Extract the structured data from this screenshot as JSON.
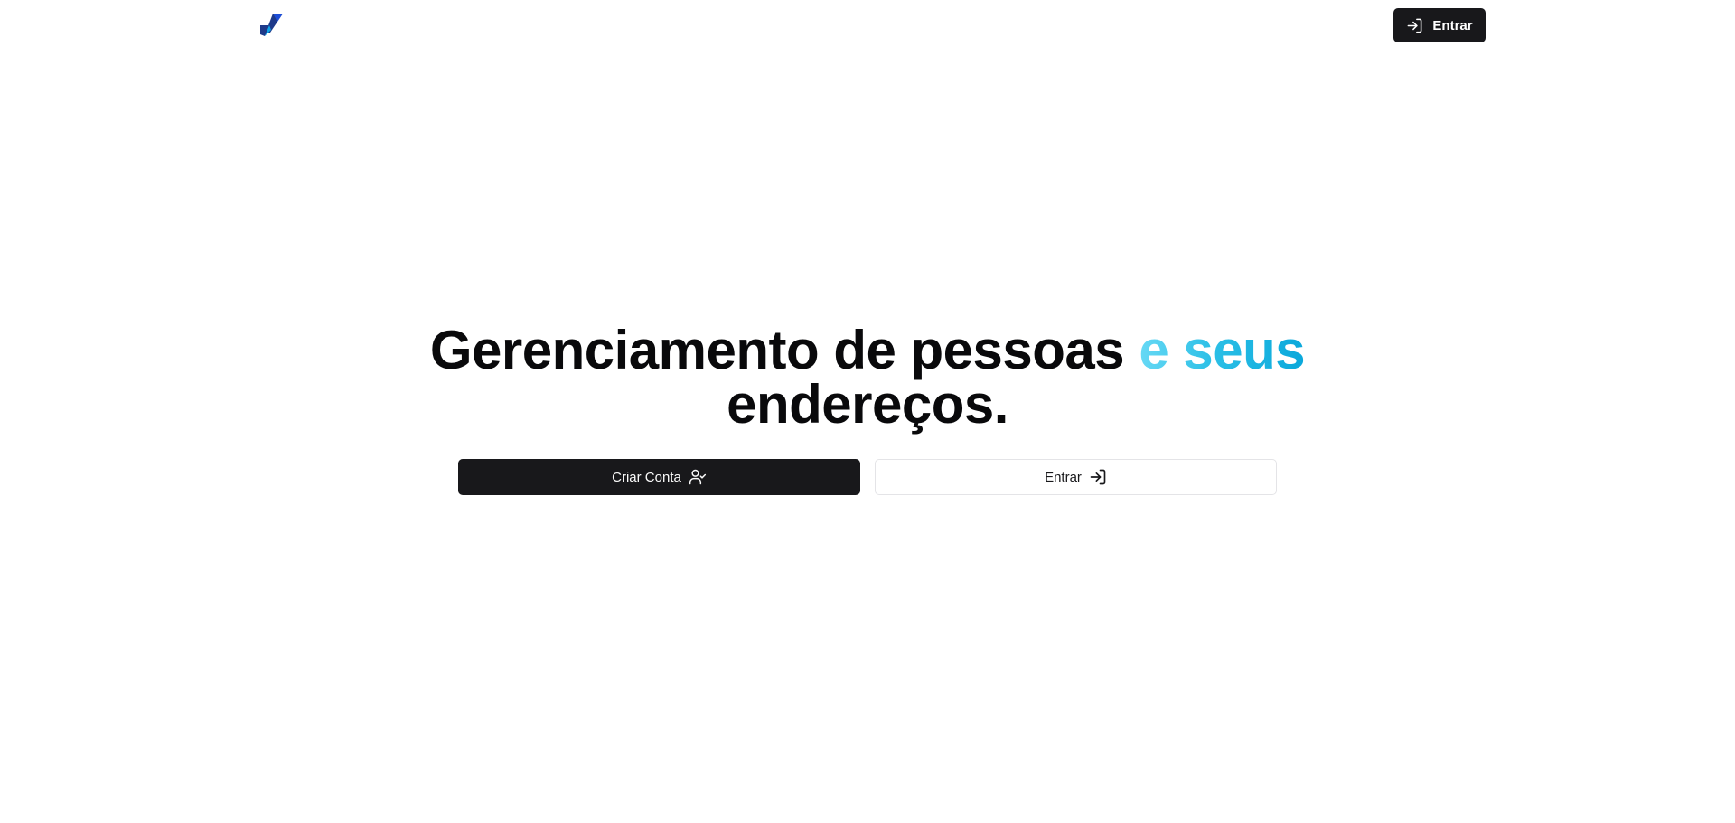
{
  "header": {
    "logo_icon": "brand-logo-icon",
    "login_label": "Entrar",
    "login_icon": "log-in-icon"
  },
  "hero": {
    "title_part1": "Gerenciamento de pessoas ",
    "title_accent": "e seus",
    "title_part2": "endereços.",
    "accent_colors": [
      "#67d9f5",
      "#0aa8db"
    ]
  },
  "actions": {
    "create_label": "Criar Conta",
    "create_icon": "user-check-icon",
    "login_label": "Entrar",
    "login_icon": "log-in-icon"
  },
  "colors": {
    "primary": "#18181b",
    "border": "#e4e4e7",
    "logo_dark": "#1e3a8a",
    "logo_light": "#0ea5e9"
  }
}
